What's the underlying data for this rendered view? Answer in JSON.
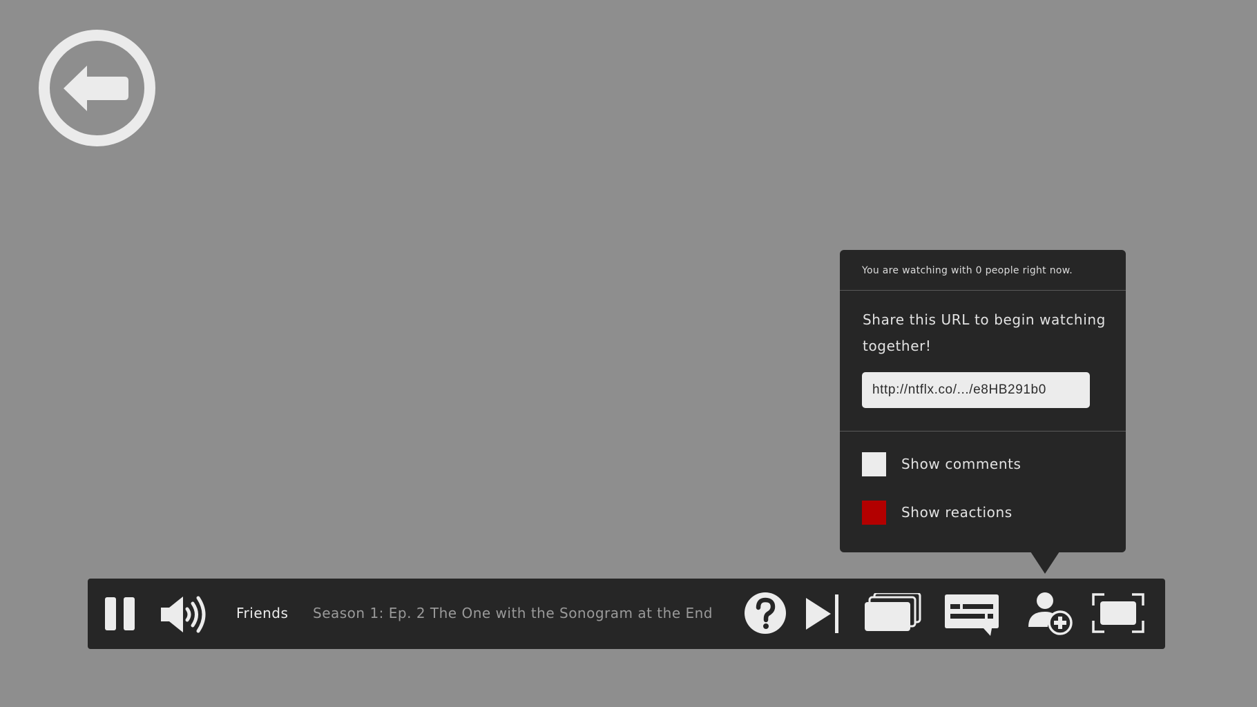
{
  "back": {
    "icon": "back-arrow-icon"
  },
  "popup": {
    "status_text": "You are watching with 0 people right now.",
    "share_text": "Share this URL to begin watching together!",
    "share_url": "http://ntflx.co/.../e8HB291b0",
    "options": [
      {
        "label": "Show comments",
        "checked": false,
        "color": "#ececec"
      },
      {
        "label": "Show reactions",
        "checked": true,
        "color": "#b30000"
      }
    ]
  },
  "player": {
    "show_title": "Friends",
    "episode_title": "Season 1: Ep. 2 The One with the Sonogram at the End",
    "icons": [
      "pause-icon",
      "volume-icon",
      "help-icon",
      "next-episode-icon",
      "episodes-icon",
      "subtitles-icon",
      "watch-party-icon",
      "fullscreen-icon"
    ]
  },
  "colors": {
    "background": "#8e8e8e",
    "panel": "#262626",
    "icon": "#ececec",
    "accent_red": "#b30000"
  }
}
